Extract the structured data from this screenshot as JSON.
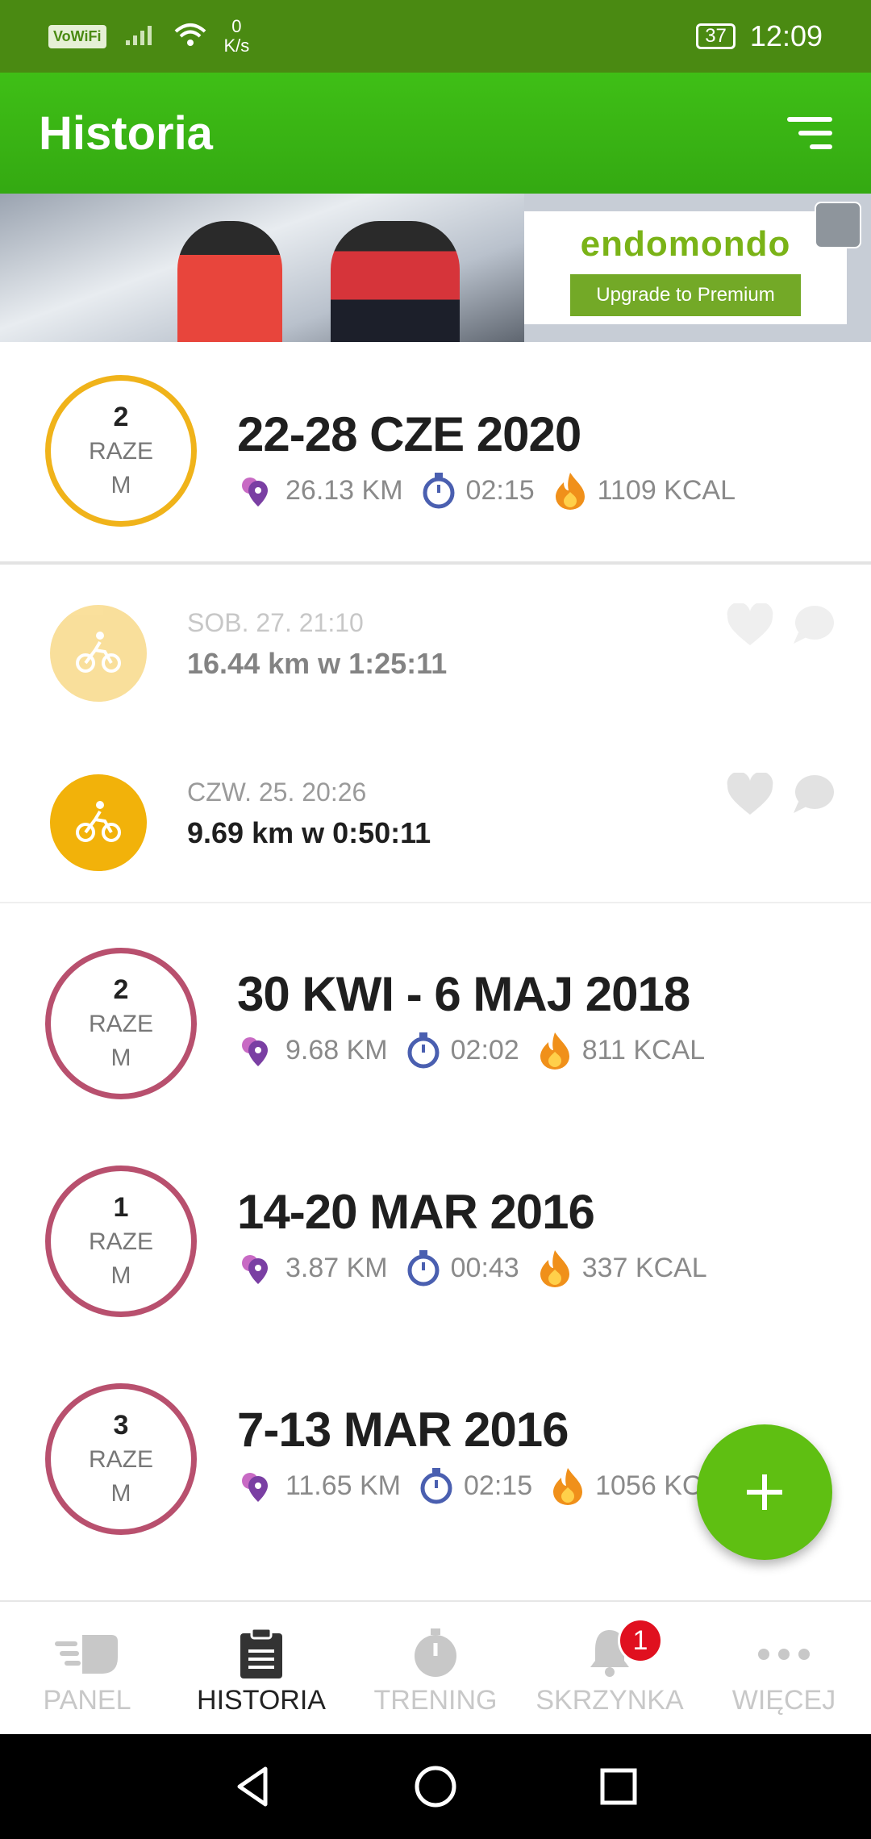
{
  "status_bar": {
    "network_badge": "VoWiFi",
    "speed_value": "0",
    "speed_unit": "K/s",
    "battery": "37",
    "time": "12:09"
  },
  "app_bar": {
    "title": "Historia"
  },
  "banner": {
    "brand": "endomondo",
    "cta": "Upgrade to Premium"
  },
  "weeks": [
    {
      "count": "2",
      "label": "RAZE M",
      "title": "22-28 CZE 2020",
      "distance": "26.13 KM",
      "duration": "02:15",
      "calories": "1109 KCAL",
      "color": "#f0b31a"
    },
    {
      "count": "2",
      "label": "RAZE M",
      "title": "30 KWI - 6 MAJ 2018",
      "distance": "9.68 KM",
      "duration": "02:02",
      "calories": "811 KCAL",
      "color": "#b8506e"
    },
    {
      "count": "1",
      "label": "RAZE M",
      "title": "14-20 MAR 2016",
      "distance": "3.87 KM",
      "duration": "00:43",
      "calories": "337 KCAL",
      "color": "#b8506e"
    },
    {
      "count": "3",
      "label": "RAZE M",
      "title": "7-13 MAR 2016",
      "distance": "11.65 KM",
      "duration": "02:15",
      "calories": "1056 KCAL",
      "color": "#b8506e"
    }
  ],
  "workouts": [
    {
      "date": "SOB. 27. 21:10",
      "summary": "16.44 km w 1:25:11",
      "icon": "bike-icon",
      "dimmed": true
    },
    {
      "date": "CZW. 25. 20:26",
      "summary": "9.69 km w 0:50:11",
      "icon": "bike-icon",
      "dimmed": false
    }
  ],
  "bottom_nav": [
    {
      "label": "PANEL",
      "icon": "dashboard-runner-icon"
    },
    {
      "label": "HISTORIA",
      "icon": "clipboard-icon",
      "active": true
    },
    {
      "label": "TRENING",
      "icon": "stopwatch-icon"
    },
    {
      "label": "SKRZYNKA",
      "icon": "bell-icon",
      "badge": "1"
    },
    {
      "label": "WIĘCEJ",
      "icon": "more-dots-icon"
    }
  ],
  "colors": {
    "status_bar": "#4a8a12",
    "app_bar": "#3cb914",
    "fab": "#5fbf12",
    "current_week_ring": "#f0b31a",
    "past_week_ring": "#b8506e",
    "badge": "#e0101f"
  }
}
